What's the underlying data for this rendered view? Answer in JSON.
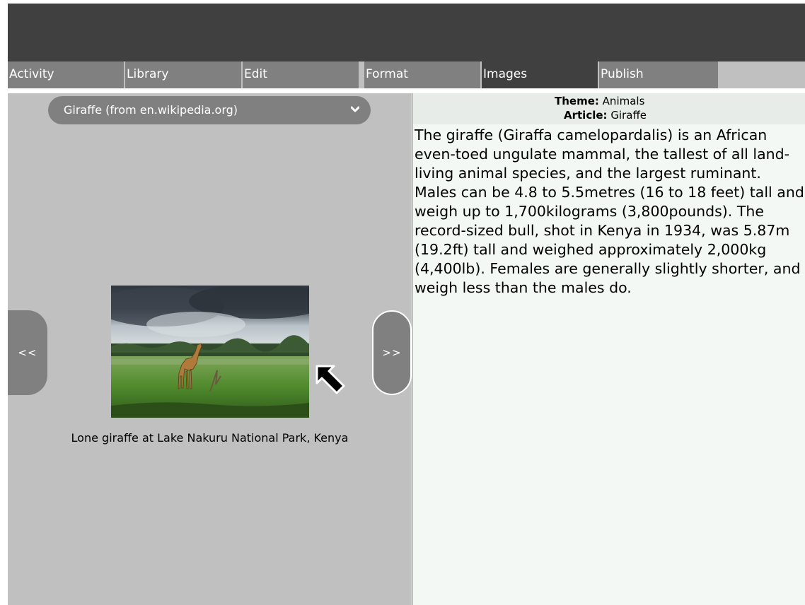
{
  "tabs": [
    {
      "label": "Activity",
      "active": false
    },
    {
      "label": "Library",
      "active": false
    },
    {
      "label": "Edit",
      "active": false
    },
    {
      "label": "Format",
      "active": false
    },
    {
      "label": "Images",
      "active": true
    },
    {
      "label": "Publish",
      "active": false
    }
  ],
  "source_combo": {
    "selected": "Giraffe (from en.wikipedia.org)",
    "icon": "chevron-down-icon"
  },
  "navigation": {
    "prev_label": "<<",
    "next_label": ">>"
  },
  "image": {
    "caption": "Lone giraffe at Lake Nakuru National Park, Kenya"
  },
  "info": {
    "theme_label": "Theme:",
    "theme_value": "Animals",
    "article_label": "Article:",
    "article_value": "Giraffe"
  },
  "article_text": "The giraffe (Giraffa camelopardalis) is an African even-toed ungulate mammal, the tallest of all land-living animal species, and the largest ruminant. Males can be 4.8 to 5.5metres (16 to 18 feet) tall and weigh up to 1,700kilograms (3,800pounds). The record-sized bull, shot in Kenya in 1934, was 5.87m (19.2ft) tall and weighed approximately 2,000kg (4,400lb). Females are generally slightly shorter, and weigh less than the males do.",
  "colors": {
    "toolbar": "#404040",
    "tab_inactive": "#808080",
    "tab_active": "#404040",
    "panel": "#c0c0c0",
    "text_panel": "#f4f8f4"
  }
}
